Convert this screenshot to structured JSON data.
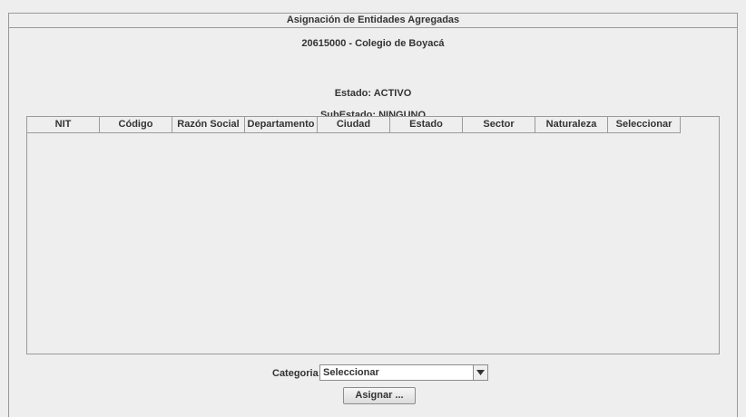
{
  "window": {
    "title": "Asignación de Entidades Agregadas"
  },
  "entity": {
    "name": "20615000 - Colegio de Boyacá"
  },
  "status": {
    "estado": "Estado: ACTIVO",
    "subestado": "SubEstado: NINGUNO"
  },
  "table": {
    "columns": [
      "NIT",
      "Código",
      "Razón Social",
      "Departamento",
      "Ciudad",
      "Estado",
      "Sector",
      "Naturaleza",
      "Seleccionar"
    ],
    "rows": []
  },
  "form": {
    "category_label": "Categoria:",
    "category_value": "Seleccionar",
    "assign_button": "Asignar ..."
  }
}
